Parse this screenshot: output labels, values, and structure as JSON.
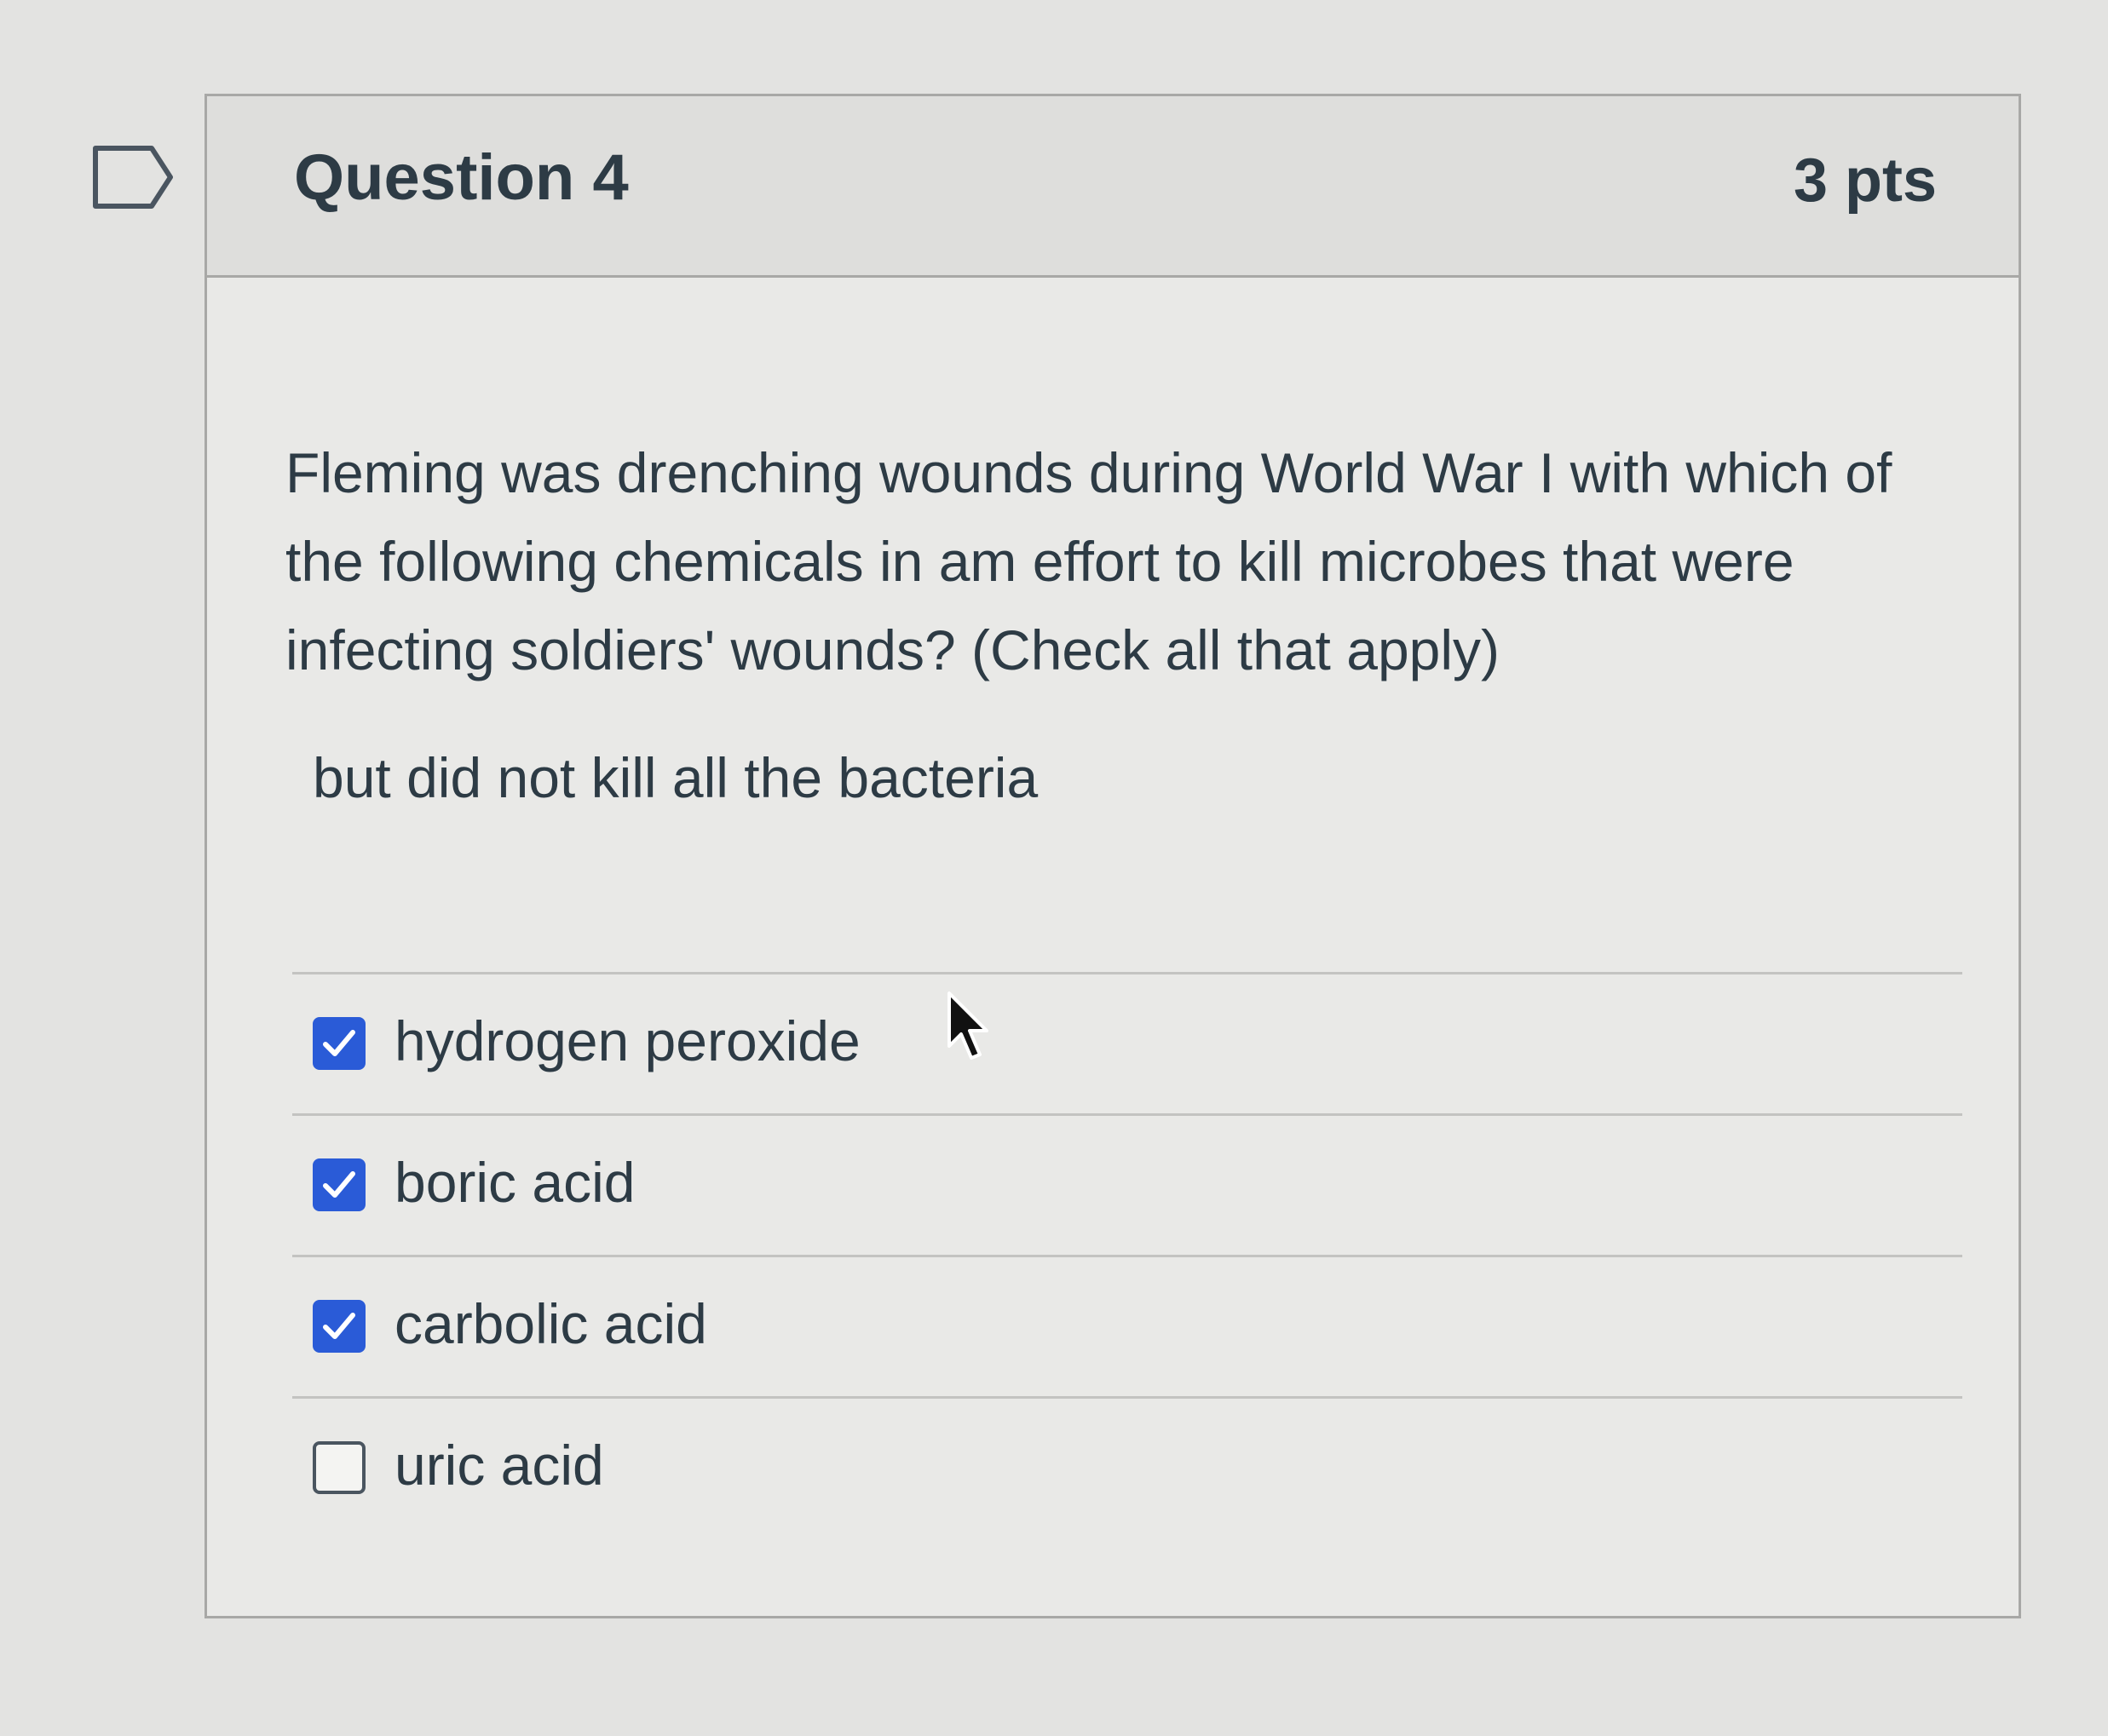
{
  "question": {
    "title": "Question 4",
    "points": "3 pts",
    "text": "Fleming was drenching wounds during World War I with which of the following chemicals in am effort to kill microbes that were infecting soldiers' wounds? (Check all that apply)",
    "note": "but did not kill all the bacteria"
  },
  "answers": [
    {
      "label": "hydrogen peroxide",
      "checked": true
    },
    {
      "label": "boric acid",
      "checked": true
    },
    {
      "label": "carbolic acid",
      "checked": true
    },
    {
      "label": "uric acid",
      "checked": false
    }
  ],
  "colors": {
    "accent": "#2a5bd7",
    "text": "#2d3b45"
  }
}
